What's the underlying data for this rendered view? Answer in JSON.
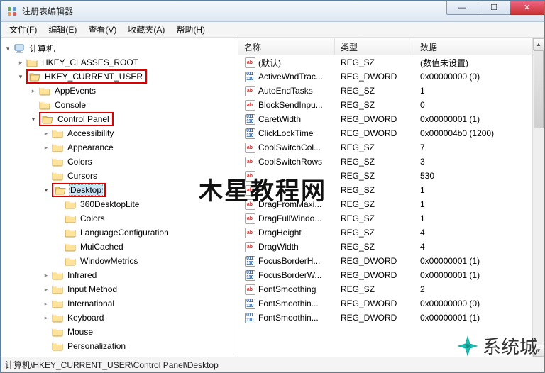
{
  "window": {
    "title": "注册表编辑器"
  },
  "menu": {
    "file": "文件(F)",
    "edit": "编辑(E)",
    "view": "查看(V)",
    "favorites": "收藏夹(A)",
    "help": "帮助(H)"
  },
  "tree": {
    "root": "计算机",
    "hkcr": "HKEY_CLASSES_ROOT",
    "hkcu": "HKEY_CURRENT_USER",
    "appEvents": "AppEvents",
    "console": "Console",
    "controlPanel": "Control Panel",
    "accessibility": "Accessibility",
    "appearance": "Appearance",
    "colors": "Colors",
    "cursors": "Cursors",
    "desktop": "Desktop",
    "desktopLite": "360DesktopLite",
    "desktopColors": "Colors",
    "langCfg": "LanguageConfiguration",
    "muiCached": "MuiCached",
    "windowMetrics": "WindowMetrics",
    "infrared": "Infrared",
    "inputMethod": "Input Method",
    "international": "International",
    "keyboard": "Keyboard",
    "mouse": "Mouse",
    "personalization": "Personalization"
  },
  "list": {
    "headers": {
      "name": "名称",
      "type": "类型",
      "data": "数据"
    },
    "rows": [
      {
        "icon": "sz",
        "name": "(默认)",
        "type": "REG_SZ",
        "data": "(数值未设置)"
      },
      {
        "icon": "dw",
        "name": "ActiveWndTrac...",
        "type": "REG_DWORD",
        "data": "0x00000000 (0)"
      },
      {
        "icon": "sz",
        "name": "AutoEndTasks",
        "type": "REG_SZ",
        "data": "1"
      },
      {
        "icon": "sz",
        "name": "BlockSendInpu...",
        "type": "REG_SZ",
        "data": "0"
      },
      {
        "icon": "dw",
        "name": "CaretWidth",
        "type": "REG_DWORD",
        "data": "0x00000001 (1)"
      },
      {
        "icon": "dw",
        "name": "ClickLockTime",
        "type": "REG_DWORD",
        "data": "0x000004b0 (1200)"
      },
      {
        "icon": "sz",
        "name": "CoolSwitchCol...",
        "type": "REG_SZ",
        "data": "7"
      },
      {
        "icon": "sz",
        "name": "CoolSwitchRows",
        "type": "REG_SZ",
        "data": "3"
      },
      {
        "icon": "sz",
        "name": "",
        "type": "REG_SZ",
        "data": "530"
      },
      {
        "icon": "sz",
        "name": "",
        "type": "REG_SZ",
        "data": "1"
      },
      {
        "icon": "sz",
        "name": "DragFromMaxi...",
        "type": "REG_SZ",
        "data": "1"
      },
      {
        "icon": "sz",
        "name": "DragFullWindo...",
        "type": "REG_SZ",
        "data": "1"
      },
      {
        "icon": "sz",
        "name": "DragHeight",
        "type": "REG_SZ",
        "data": "4"
      },
      {
        "icon": "sz",
        "name": "DragWidth",
        "type": "REG_SZ",
        "data": "4"
      },
      {
        "icon": "dw",
        "name": "FocusBorderH...",
        "type": "REG_DWORD",
        "data": "0x00000001 (1)"
      },
      {
        "icon": "dw",
        "name": "FocusBorderW...",
        "type": "REG_DWORD",
        "data": "0x00000001 (1)"
      },
      {
        "icon": "sz",
        "name": "FontSmoothing",
        "type": "REG_SZ",
        "data": "2"
      },
      {
        "icon": "dw",
        "name": "FontSmoothin...",
        "type": "REG_DWORD",
        "data": "0x00000000 (0)"
      },
      {
        "icon": "dw",
        "name": "FontSmoothin...",
        "type": "REG_DWORD",
        "data": "0x00000001 (1)"
      }
    ]
  },
  "statusbar": {
    "path": "计算机\\HKEY_CURRENT_USER\\Control Panel\\Desktop"
  },
  "watermarks": {
    "center": "木星教程网",
    "br": "系统城"
  }
}
